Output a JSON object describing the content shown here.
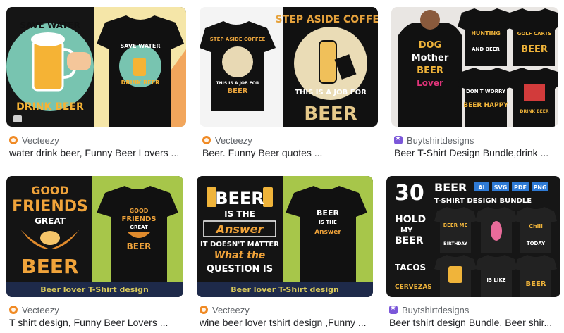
{
  "results": [
    {
      "source": "Vecteezy",
      "title": "water drink beer, Funny Beer Lovers ...",
      "art": {
        "top": "SAVE WATER",
        "bottom": "DRINK BEER",
        "shirt_top": "SAVE WATER",
        "shirt_bottom": "DRINK BEER"
      }
    },
    {
      "source": "Vecteezy",
      "title": "Beer. Funny Beer quotes ...",
      "art": {
        "top": "STEP ASIDE COFFEE",
        "middle": "THIS IS A JOB FOR",
        "bottom": "BEER",
        "shirt_top": "STEP ASIDE COFFEE",
        "shirt_middle": "THIS IS A JOB FOR",
        "shirt_bottom": "BEER"
      }
    },
    {
      "source": "Buytshirtdesigns",
      "title": "Beer T-Shirt Design Bundle,drink ...",
      "art": {
        "model_l1": "DOG",
        "model_l2": "Mother",
        "model_l3": "BEER",
        "model_l4": "Lover",
        "s1a": "HUNTING",
        "s1b": "AND BEER",
        "s2a": "GOLF CARTS",
        "s2b": "BEER",
        "s3a": "DON'T WORRY",
        "s3b": "BEER HAPPY",
        "s4a": "DRINK BEER"
      }
    },
    {
      "source": "Vecteezy",
      "title": "T shirt design, Funny Beer Lovers ...",
      "art": {
        "l1": "GOOD",
        "l2": "FRIENDS",
        "l3": "GREAT",
        "l4": "BEER",
        "shirt_l1": "GOOD",
        "shirt_l2": "FRIENDS",
        "shirt_l3": "GREAT",
        "shirt_l4": "BEER",
        "banner": "Beer lover T-Shirt design"
      }
    },
    {
      "source": "Vecteezy",
      "title": "wine beer lover tshirt design ,Funny ...",
      "art": {
        "l1": "BEER",
        "l2": "IS THE",
        "l3": "Answer",
        "l4": "IT DOESN'T MATTER",
        "l5": "What the",
        "l6": "QUESTION IS",
        "shirt_l1": "BEER",
        "shirt_l2": "IS THE",
        "shirt_l3": "Answer",
        "banner": "Beer lover T-Shirt design"
      }
    },
    {
      "source": "Buytshirtdesigns",
      "title": "Beer tshirt design Bundle, Beer shir...",
      "art": {
        "count": "30",
        "headline": "BEER",
        "sub": "T-SHIRT DESIGN BUNDLE",
        "tags": [
          "AI",
          "SVG",
          "PDF",
          "PNG"
        ],
        "d1a": "HOLD",
        "d1b": "MY",
        "d1c": "BEER",
        "d2a": "BEER ME",
        "d2b": "BIRTHDAY",
        "d3a": "Chill",
        "d3b": "TODAY",
        "d4a": "TACOS",
        "d4b": "CERVEZAS",
        "d5a": "IS LIKE",
        "d6a": "BEER"
      }
    }
  ]
}
